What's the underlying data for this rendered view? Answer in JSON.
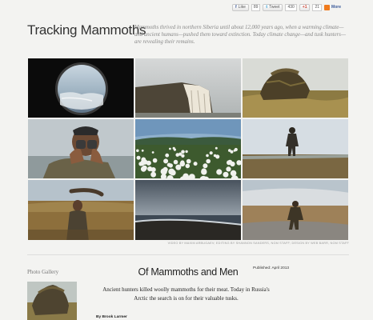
{
  "social": {
    "like_label": "Like",
    "like_count": "89",
    "tweet_label": "Tweet",
    "tweet_count": "430",
    "gplus_count": "21",
    "more_label": "More"
  },
  "header": {
    "title": "Tracking Mammoths",
    "deck": "Mammoths thrived in northern Siberia until about 12,000 years ago, when a warming climate—and ancient humans—pushed them toward extinction. Today climate change—and tusk hunters—are revealing their remains."
  },
  "gallery_grid": {
    "credit": "VIDEO BY MAXIM ARBUGAEV; EDITING BY SHANNON SANDERS, NGM STAFF; DESIGN BY WEB BARR, NGM STAFF"
  },
  "sidebar": {
    "label": "Photo Gallery"
  },
  "article": {
    "headline": "Of Mammoths and Men",
    "published": "Published: April 2013",
    "intro": "Ancient hunters killed woolly mammoths for their meat. Today in Russia's Arctic the search is on for their valuable tusks.",
    "byline": "By Brook Larmer"
  },
  "colors": {
    "background": "#f3f3f1",
    "facebook": "#3b5998",
    "twitter": "#2a9fd8",
    "share_more": "#f07b1d"
  }
}
